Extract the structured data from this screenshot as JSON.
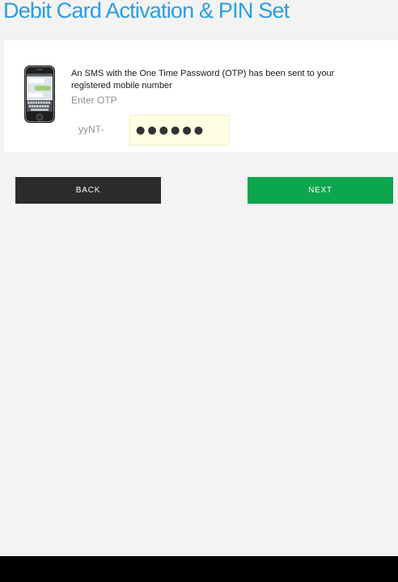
{
  "page": {
    "title": "Debit Card Activation & PIN Set"
  },
  "otp": {
    "message": "An SMS with the One Time Password (OTP) has been sent to your registered mobile number",
    "prompt": "Enter OTP",
    "prefix": "yyNT-",
    "value": "●●●●●●",
    "icon": "phone-sms-icon"
  },
  "actions": {
    "back_label": "BACK",
    "next_label": "NEXT"
  },
  "colors": {
    "title": "#2a9ee0",
    "back_button": "#2b2b2b",
    "next_button": "#0ba64d",
    "otp_field": "#ffffe3",
    "page_background": "#f3f3f3"
  }
}
